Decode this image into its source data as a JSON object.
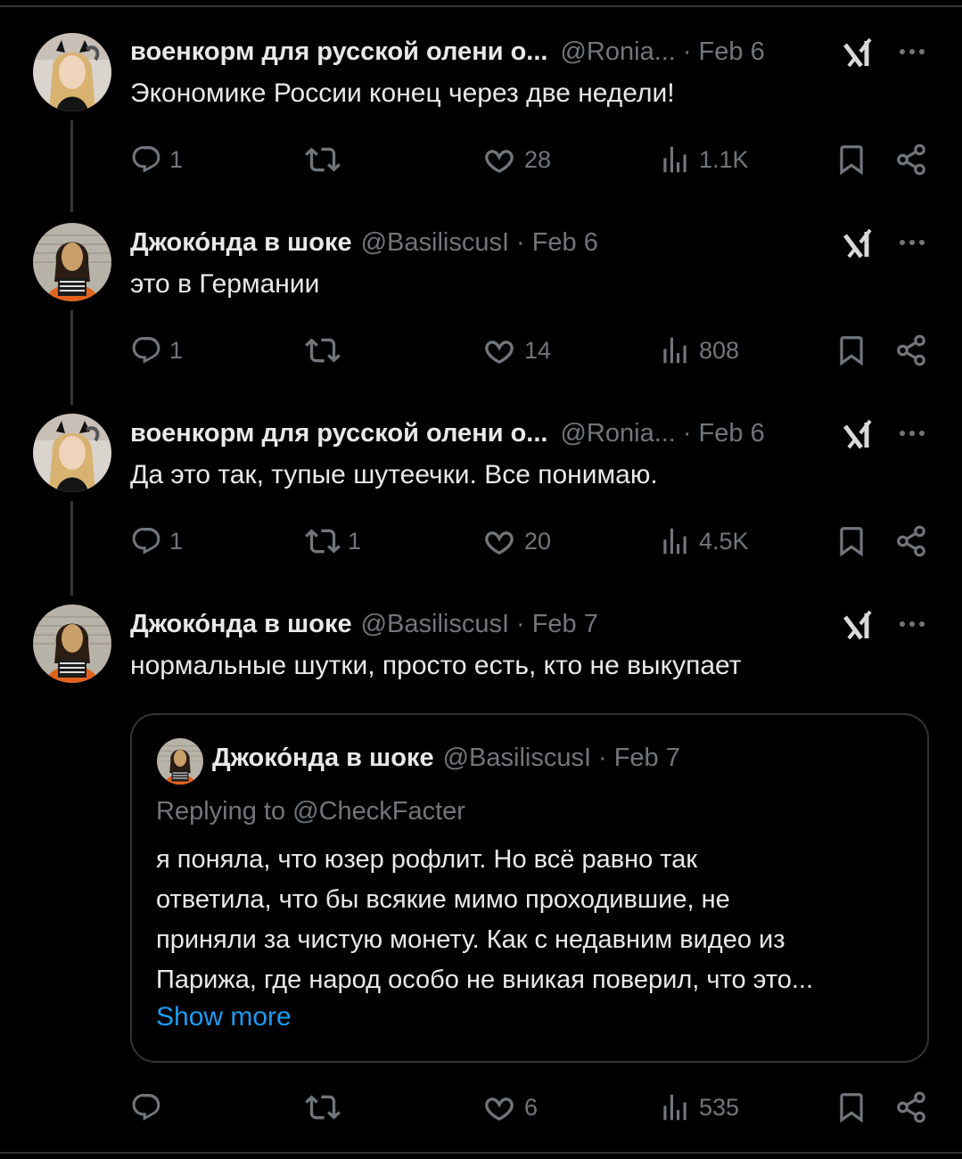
{
  "tweets": [
    {
      "name": "военкорм для русской олени о...",
      "handle": "@Ronia...",
      "date": "Feb 6",
      "text": "Экономике России конец через две недели!",
      "replies": "1",
      "retweets": "",
      "likes": "28",
      "views": "1.1K",
      "avatar": "blonde-woman-avatar"
    },
    {
      "name": "Джоко́нда в шоке",
      "handle": "@BasiliscusI",
      "date": "Feb 6",
      "text": "это в Германии",
      "replies": "1",
      "retweets": "",
      "likes": "14",
      "views": "808",
      "avatar": "mona-lisa-mugshot-avatar"
    },
    {
      "name": "военкорм для русской олени о...",
      "handle": "@Ronia...",
      "date": "Feb 6",
      "text": "Да это так, тупые шутеечки. Все понимаю.",
      "replies": "1",
      "retweets": "1",
      "likes": "20",
      "views": "4.5K",
      "avatar": "blonde-woman-avatar"
    },
    {
      "name": "Джоко́нда в шоке",
      "handle": "@BasiliscusI",
      "date": "Feb 7",
      "text": "нормальные шутки, просто есть, кто не выкупает",
      "replies": "",
      "retweets": "",
      "likes": "6",
      "views": "535",
      "avatar": "mona-lisa-mugshot-avatar"
    }
  ],
  "quote": {
    "name": "Джоко́нда в шоке",
    "handle": "@BasiliscusI",
    "date": "Feb 7",
    "replying_to": "Replying to @CheckFacter",
    "lines": [
      "я поняла, что юзер рофлит. Но всё равно так",
      "ответила, что бы всякие мимо проходившие, не",
      "приняли за чистую монету. Как с недавним видео из",
      "Парижа, где народ особо не вникая поверил, что это..."
    ],
    "show_more": "Show more"
  },
  "colors": {
    "background": "#000000",
    "text": "#e7e9ea",
    "muted": "#71767b",
    "link": "#1d9bf0",
    "border": "#2f3336"
  },
  "icons": [
    "reply-icon",
    "retweet-icon",
    "like-icon",
    "views-icon",
    "bookmark-icon",
    "share-icon",
    "grok-icon",
    "more-icon"
  ]
}
